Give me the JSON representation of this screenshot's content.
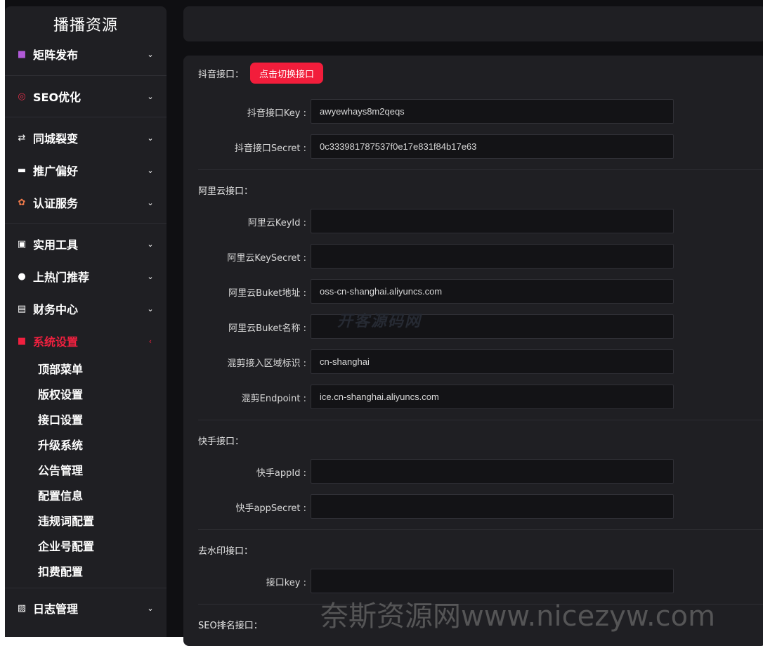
{
  "sidebar": {
    "brand": "播播资源",
    "menu": [
      {
        "icon": "video-icon",
        "glyph": "■",
        "label": "矩阵发布",
        "chevron": "⌄"
      },
      {
        "icon": "seo-icon",
        "glyph": "◎",
        "label": "SEO优化",
        "chevron": "⌄"
      },
      {
        "icon": "swap-icon",
        "glyph": "⇄",
        "label": "同城裂变",
        "chevron": "⌄"
      },
      {
        "icon": "robot-icon",
        "glyph": "▬",
        "label": "推广偏好",
        "chevron": "⌄"
      },
      {
        "icon": "certify-icon",
        "glyph": "✿",
        "label": "认证服务",
        "chevron": "⌄"
      },
      {
        "icon": "toolbox-icon",
        "glyph": "▣",
        "label": "实用工具",
        "chevron": "⌄"
      },
      {
        "icon": "fire-icon",
        "glyph": "●",
        "label": "上热门推荐",
        "chevron": "⌄"
      },
      {
        "icon": "finance-icon",
        "glyph": "▤",
        "label": "财务中心",
        "chevron": "⌄"
      },
      {
        "icon": "settings-icon",
        "glyph": "■",
        "label": "系统设置",
        "chevron": "‹"
      },
      {
        "icon": "log-icon",
        "glyph": "▨",
        "label": "日志管理",
        "chevron": "⌄"
      }
    ],
    "submenu": [
      "顶部菜单",
      "版权设置",
      "接口设置",
      "升级系统",
      "公告管理",
      "配置信息",
      "违规词配置",
      "企业号配置",
      "扣费配置"
    ]
  },
  "colors": {
    "accent": "#f21d3b",
    "panel": "#1f1f23",
    "field": "#131316"
  },
  "form": {
    "douyin": {
      "title": "抖音接口：",
      "switch_button": "点击切换接口",
      "key_label": "抖音接口Key :",
      "key_value": "awyewhays8m2qeqs",
      "secret_label": "抖音接口Secret :",
      "secret_value": "0c333981787537f0e17e831f84b17e63"
    },
    "aliyun": {
      "title": "阿里云接口：",
      "keyid_label": "阿里云KeyId :",
      "keyid_value": "",
      "keysecret_label": "阿里云KeySecret :",
      "keysecret_value": "",
      "bucket_addr_label": "阿里云Buket地址 :",
      "bucket_addr_value": "oss-cn-shanghai.aliyuncs.com",
      "bucket_name_label": "阿里云Buket名称 :",
      "bucket_name_value": "",
      "region_label": "混剪接入区域标识 :",
      "region_value": "cn-shanghai",
      "endpoint_label": "混剪Endpoint :",
      "endpoint_value": "ice.cn-shanghai.aliyuncs.com"
    },
    "kuaishou": {
      "title": "快手接口：",
      "appid_label": "快手appId :",
      "appid_value": "",
      "appsecret_label": "快手appSecret :",
      "appsecret_value": ""
    },
    "watermark_removal": {
      "title": "去水印接口：",
      "key_label": "接口key :",
      "key_value": ""
    },
    "seo_rank": {
      "title": "SEO排名接口："
    }
  },
  "overlay": {
    "inner_watermark": "开客源码网",
    "watermark": "奈斯资源网www.nicezyw.com"
  }
}
